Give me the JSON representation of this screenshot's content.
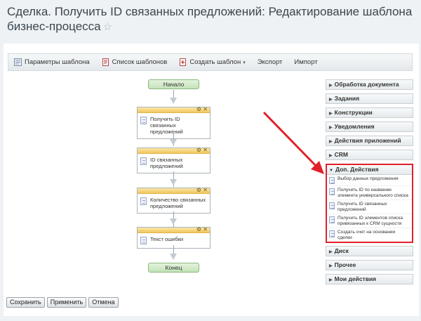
{
  "page": {
    "title": "Сделка. Получить ID связанных предложений: Редактирование шаблона бизнес-процесса",
    "star": "☆"
  },
  "toolbar": {
    "items": [
      {
        "label": "Параметры шаблона",
        "icon": "template-settings-icon"
      },
      {
        "label": "Список шаблонов",
        "icon": "template-list-icon"
      },
      {
        "label": "Создать шаблон",
        "icon": "create-template-icon",
        "caret": "▾"
      },
      {
        "label": "Экспорт"
      },
      {
        "label": "Импорт"
      }
    ]
  },
  "flow": {
    "start": "Начало",
    "end": "Конец",
    "activities": [
      "Получить ID связанных предложений",
      "ID связанных предложений",
      "Количество связанных предложений",
      "Текст ошибки"
    ]
  },
  "sidebar": {
    "sections_before": [
      "Обработка документа",
      "Задания",
      "Конструкции",
      "Уведомления",
      "Действия приложений",
      "CRM"
    ],
    "open_section": {
      "title": "Доп. Действия",
      "items": [
        "Выбор данных предложения",
        "Получить ID по названию элемента универсального списка",
        "Получить ID связанных предложений",
        "Получить ID элементов списка привязанных к CRM сущности",
        "Создать счет на основании сделки"
      ]
    },
    "sections_after": [
      "Диск",
      "Прочее",
      "Мои действия"
    ]
  },
  "buttons": {
    "save": "Сохранить",
    "apply": "Применить",
    "cancel": "Отмена"
  },
  "colors": {
    "highlight": "#e1212a",
    "arrow": "#e1212a",
    "start_end_fill": "#c4e3b8",
    "activity_header": "#f2c65c"
  }
}
